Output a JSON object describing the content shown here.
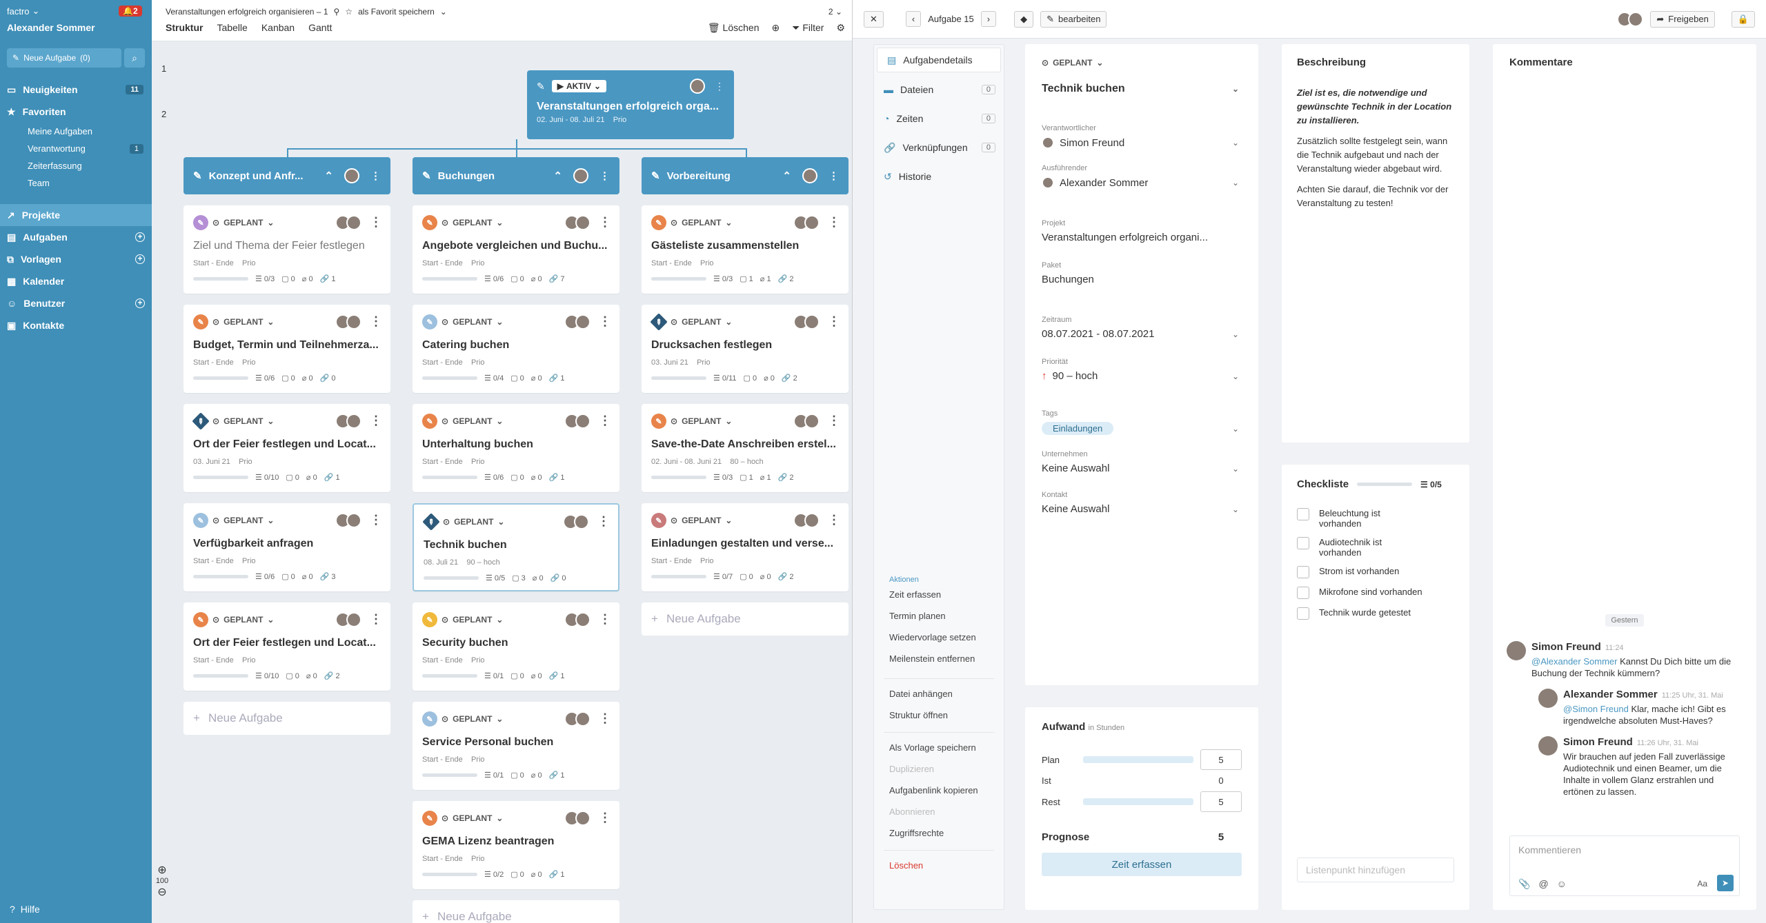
{
  "sidebar": {
    "brand": "factro",
    "notifications": "2",
    "user": "Alexander Sommer",
    "new_task": "Neue Aufgabe",
    "new_task_count": "(0)",
    "items": [
      {
        "label": "Neuigkeiten",
        "count": "11"
      },
      {
        "label": "Favoriten"
      }
    ],
    "favorites": [
      {
        "label": "Meine Aufgaben"
      },
      {
        "label": "Verantwortung",
        "count": "1"
      },
      {
        "label": "Zeiterfassung"
      },
      {
        "label": "Team"
      }
    ],
    "main": [
      {
        "label": "Projekte"
      },
      {
        "label": "Aufgaben"
      },
      {
        "label": "Vorlagen"
      },
      {
        "label": "Kalender"
      },
      {
        "label": "Benutzer"
      },
      {
        "label": "Kontakte"
      }
    ],
    "help": "Hilfe"
  },
  "board": {
    "title": "Veranstaltungen erfolgreich organisieren – 1",
    "favorite": "als Favorit speichern",
    "page": "2",
    "tabs": [
      "Struktur",
      "Tabelle",
      "Kanban",
      "Gantt"
    ],
    "delete": "Löschen",
    "filter": "Filter",
    "row1": "1",
    "row2": "2",
    "zoom": "100",
    "root": {
      "status": "AKTIV",
      "title": "Veranstaltungen erfolgreich orga...",
      "dates": "02. Juni - 08. Juli 21",
      "prio": "Prio"
    },
    "new_task": "Neue Aufgabe",
    "columns": [
      {
        "title": "Konzept und Anfr...",
        "cards": [
          {
            "status": "GEPLANT",
            "title": "Ziel und Thema der Feier festlegen",
            "start": "Start - Ende",
            "prio": "Prio",
            "chk": "0/3",
            "c": "0",
            "a": "0",
            "l": "1",
            "icon": "#b58fd6",
            "muted": true
          },
          {
            "status": "GEPLANT",
            "title": "Budget, Termin und Teilnehmerza...",
            "start": "Start - Ende",
            "prio": "Prio",
            "chk": "0/6",
            "c": "0",
            "a": "0",
            "l": "0",
            "icon": "#e8844a"
          },
          {
            "status": "GEPLANT",
            "title": "Ort der Feier festlegen und Locat...",
            "start": "03. Juni 21",
            "prio": "Prio",
            "chk": "0/10",
            "c": "0",
            "a": "0",
            "l": "1",
            "icon": "#2d5a7a",
            "diamond": true
          },
          {
            "status": "GEPLANT",
            "title": "Verfügbarkeit anfragen",
            "start": "Start - Ende",
            "prio": "Prio",
            "chk": "0/6",
            "c": "0",
            "a": "0",
            "l": "3",
            "icon": "#9cc0de"
          },
          {
            "status": "GEPLANT",
            "title": "Ort der Feier festlegen und Locat...",
            "start": "Start - Ende",
            "prio": "Prio",
            "chk": "0/10",
            "c": "0",
            "a": "0",
            "l": "2",
            "icon": "#e8844a"
          }
        ]
      },
      {
        "title": "Buchungen",
        "cards": [
          {
            "status": "GEPLANT",
            "title": "Angebote vergleichen und Buchu...",
            "start": "Start - Ende",
            "prio": "Prio",
            "chk": "0/6",
            "c": "0",
            "a": "0",
            "l": "7",
            "icon": "#e8844a"
          },
          {
            "status": "GEPLANT",
            "title": "Catering buchen",
            "start": "Start - Ende",
            "prio": "Prio",
            "chk": "0/4",
            "c": "0",
            "a": "0",
            "l": "1",
            "icon": "#9cc0de"
          },
          {
            "status": "GEPLANT",
            "title": "Unterhaltung buchen",
            "start": "Start - Ende",
            "prio": "Prio",
            "chk": "0/6",
            "c": "0",
            "a": "0",
            "l": "1",
            "icon": "#e8844a"
          },
          {
            "status": "GEPLANT",
            "title": "Technik buchen",
            "start": "08. Juli 21",
            "prio": "90 – hoch",
            "chk": "0/5",
            "c": "3",
            "a": "0",
            "l": "0",
            "icon": "#2d5a7a",
            "diamond": true,
            "sel": true
          },
          {
            "status": "GEPLANT",
            "title": "Security buchen",
            "start": "Start - Ende",
            "prio": "Prio",
            "chk": "0/1",
            "c": "0",
            "a": "0",
            "l": "1",
            "icon": "#f0b93b"
          },
          {
            "status": "GEPLANT",
            "title": "Service Personal buchen",
            "start": "Start - Ende",
            "prio": "Prio",
            "chk": "0/1",
            "c": "0",
            "a": "0",
            "l": "1",
            "icon": "#9cc0de"
          },
          {
            "status": "GEPLANT",
            "title": "GEMA Lizenz beantragen",
            "start": "Start - Ende",
            "prio": "Prio",
            "chk": "0/2",
            "c": "0",
            "a": "0",
            "l": "1",
            "icon": "#e8844a"
          }
        ]
      },
      {
        "title": "Vorbereitung",
        "cards": [
          {
            "status": "GEPLANT",
            "title": "Gästeliste zusammenstellen",
            "start": "Start - Ende",
            "prio": "Prio",
            "chk": "0/3",
            "c": "1",
            "a": "1",
            "l": "2",
            "icon": "#e8844a"
          },
          {
            "status": "GEPLANT",
            "title": "Drucksachen festlegen",
            "start": "03. Juni 21",
            "prio": "Prio",
            "chk": "0/11",
            "c": "0",
            "a": "0",
            "l": "2",
            "icon": "#2d5a7a",
            "diamond": true
          },
          {
            "status": "GEPLANT",
            "title": "Save-the-Date Anschreiben erstel...",
            "start": "02. Juni - 08. Juni 21",
            "prio": "80 – hoch",
            "chk": "0/3",
            "c": "1",
            "a": "1",
            "l": "2",
            "icon": "#e8844a"
          },
          {
            "status": "GEPLANT",
            "title": "Einladungen gestalten und verse...",
            "start": "Start - Ende",
            "prio": "Prio",
            "chk": "0/7",
            "c": "0",
            "a": "0",
            "l": "2",
            "icon": "#c97a7a"
          }
        ]
      }
    ]
  },
  "detail": {
    "task": "Aufgabe 15",
    "edit": "bearbeiten",
    "share": "Freigeben",
    "nav": [
      {
        "label": "Aufgabendetails"
      },
      {
        "label": "Dateien",
        "count": "0"
      },
      {
        "label": "Zeiten",
        "count": "0"
      },
      {
        "label": "Verknüpfungen",
        "count": "0"
      },
      {
        "label": "Historie"
      }
    ],
    "actions_head": "Aktionen",
    "actions": [
      "Zeit erfassen",
      "Termin planen",
      "Wiedervorlage setzen",
      "Meilenstein entfernen"
    ],
    "actions2": [
      "Datei anhängen",
      "Struktur öffnen"
    ],
    "actions3": [
      "Als Vorlage speichern",
      "Duplizieren",
      "Aufgabenlink kopieren",
      "Abonnieren",
      "Zugriffsrechte"
    ],
    "delete": "Löschen",
    "status": "GEPLANT",
    "title": "Technik buchen",
    "fields": {
      "resp_lbl": "Verantwortlicher",
      "resp": "Simon Freund",
      "exec_lbl": "Ausführender",
      "exec": "Alexander Sommer",
      "proj_lbl": "Projekt",
      "proj": "Veranstaltungen erfolgreich organi...",
      "pkg_lbl": "Paket",
      "pkg": "Buchungen",
      "time_lbl": "Zeitraum",
      "time": "08.07.2021 - 08.07.2021",
      "prio_lbl": "Priorität",
      "prio": "90 – hoch",
      "tags_lbl": "Tags",
      "tag": "Einladungen",
      "comp_lbl": "Unternehmen",
      "comp": "Keine Auswahl",
      "contact_lbl": "Kontakt",
      "contact": "Keine Auswahl"
    },
    "effort": {
      "title": "Aufwand",
      "unit": "in Stunden",
      "plan_lbl": "Plan",
      "plan": "5",
      "ist_lbl": "Ist",
      "ist": "0",
      "rest_lbl": "Rest",
      "rest": "5",
      "prog_lbl": "Prognose",
      "prog": "5",
      "button": "Zeit erfassen",
      "plan_progress": 0,
      "rest_progress": 0
    },
    "desc": {
      "title": "Beschreibung",
      "p1": "Ziel ist es, die notwendige und gewünschte Technik in der Location zu installieren.",
      "p2": "Zusätzlich sollte festgelegt sein, wann die Technik aufgebaut und nach der Veranstaltung wieder abgebaut wird.",
      "p3": "Achten Sie darauf, die Technik vor der Veranstaltung zu testen!"
    },
    "checklist": {
      "title": "Checkliste",
      "count": "0/5",
      "items": [
        "Beleuchtung ist vorhanden",
        "Audiotechnik ist vorhanden",
        "Strom ist vorhanden",
        "Mikrofone sind vorhanden",
        "Technik wurde getestet"
      ],
      "add": "Listenpunkt hinzufügen"
    },
    "comments": {
      "title": "Kommentare",
      "day": "Gestern",
      "list": [
        {
          "name": "Simon Freund",
          "time": "11:24",
          "mention": "@Alexander Sommer",
          "text": " Kannst Du Dich bitte um die Buchung der Technik kümmern?"
        },
        {
          "name": "Alexander Sommer",
          "time": "11:25 Uhr, 31. Mai",
          "mention": "@Simon Freund",
          "text": " Klar, mache ich! Gibt es irgendwelche absoluten Must-Haves?"
        },
        {
          "name": "Simon Freund",
          "time": "11:26 Uhr, 31. Mai",
          "mention": "",
          "text": "Wir brauchen auf jeden Fall zuverlässige Audiotechnik und einen Beamer, um die Inhalte in vollem Glanz erstrahlen und ertönen zu lassen."
        }
      ],
      "placeholder": "Kommentieren",
      "font": "Aa"
    }
  }
}
